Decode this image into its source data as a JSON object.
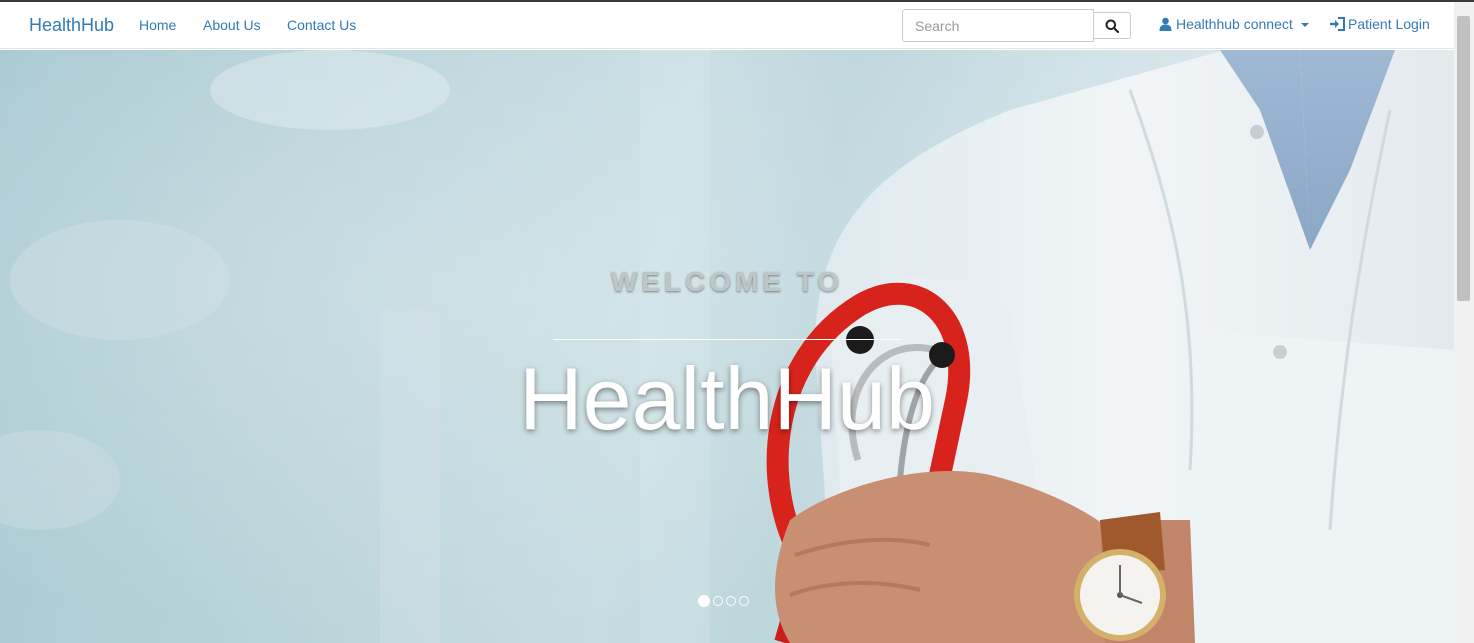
{
  "navbar": {
    "brand": "HealthHub",
    "links": [
      {
        "label": "Home"
      },
      {
        "label": "About Us"
      },
      {
        "label": "Contact Us"
      }
    ],
    "search": {
      "placeholder": "Search",
      "value": ""
    },
    "dropdown_label": "Healthhub connect",
    "login_label": "Patient Login"
  },
  "hero": {
    "kicker": "WELCOME TO",
    "title": "HealthHub",
    "slide_count": 4,
    "active_slide": 1
  },
  "icons": {
    "search": "search-icon",
    "user": "user-icon",
    "login": "login-icon",
    "caret": "caret-down-icon"
  },
  "colors": {
    "link": "#337ab7",
    "stethoscope": "#d8231c"
  }
}
